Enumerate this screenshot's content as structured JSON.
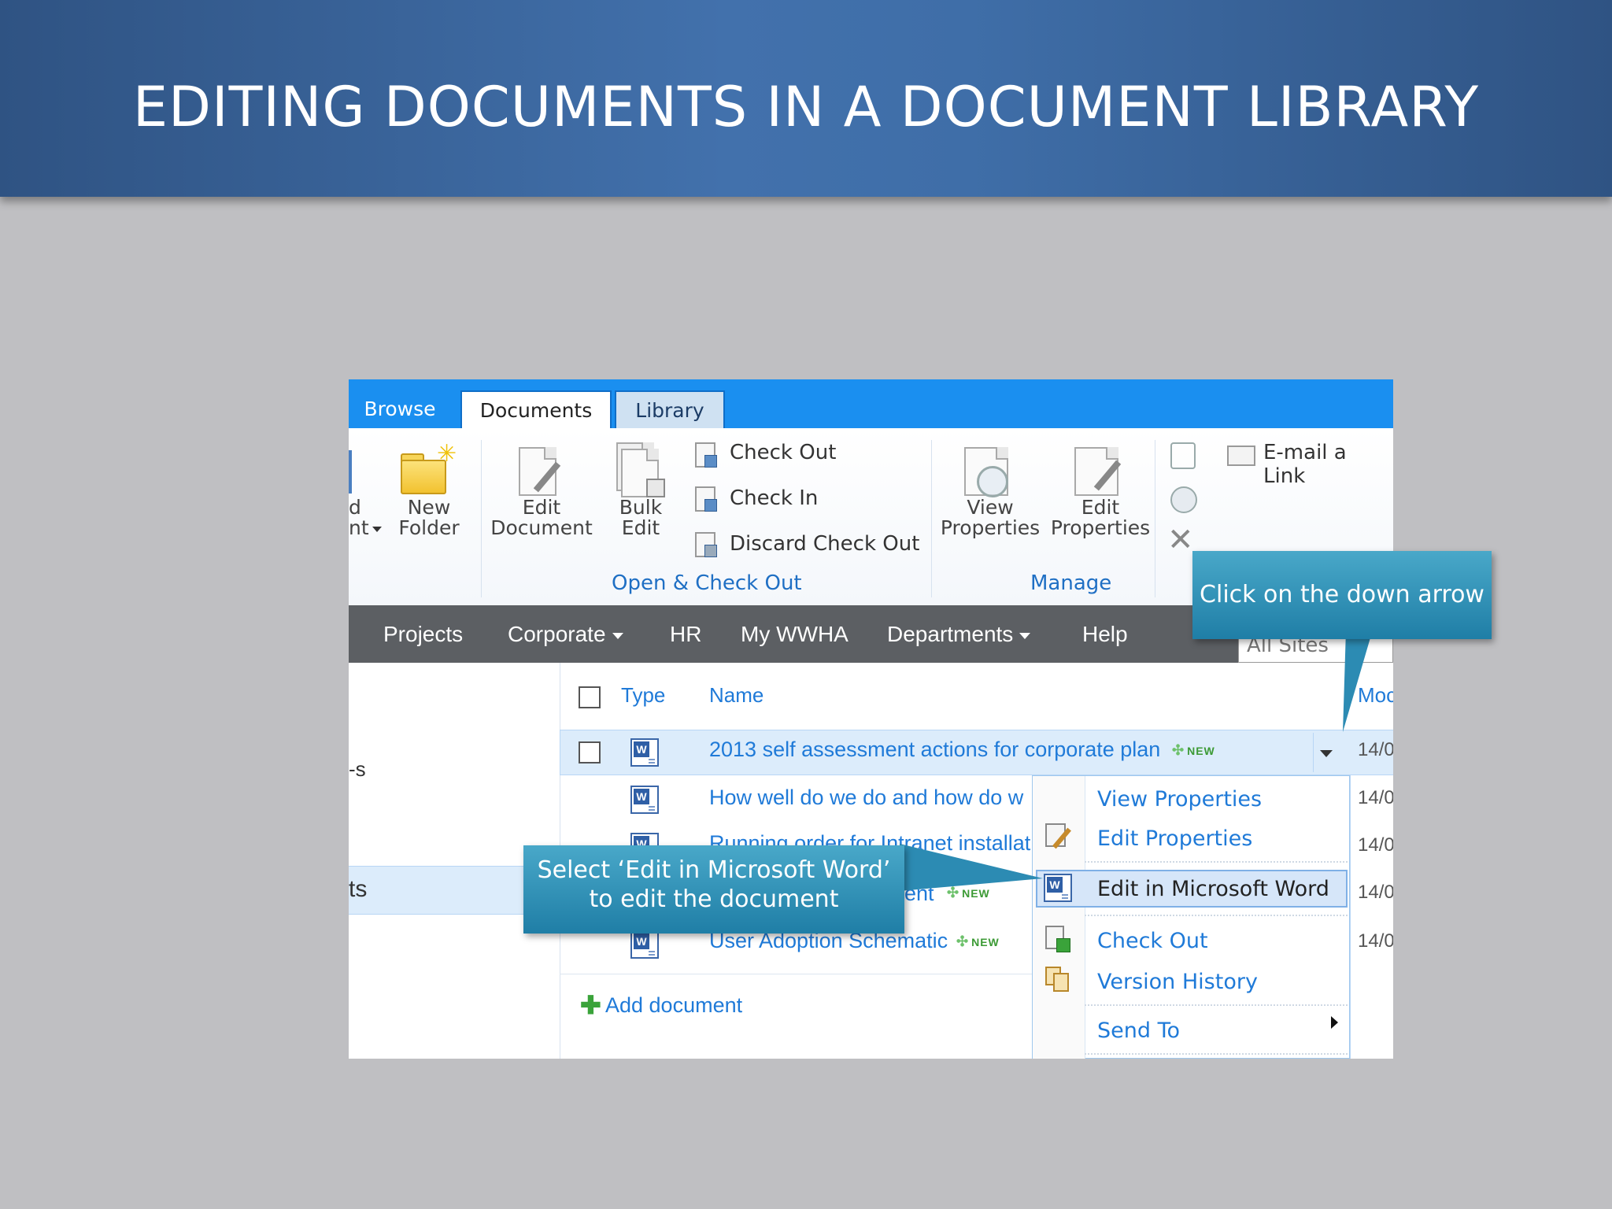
{
  "slide": {
    "title": "EDITING DOCUMENTS IN A DOCUMENT LIBRARY"
  },
  "ribbon": {
    "tabs": [
      "Browse",
      "Documents",
      "Library"
    ],
    "partial_new_doc_line1": "d",
    "partial_new_doc_line2": "nt",
    "new_folder_line1": "New",
    "new_folder_line2": "Folder",
    "edit_document_line1": "Edit",
    "edit_document_line2": "Document",
    "bulk_edit_line1": "Bulk",
    "bulk_edit_line2": "Edit",
    "check_out": "Check Out",
    "check_in": "Check In",
    "discard_check_out": "Discard Check Out",
    "group_open_checkout": "Open & Check Out",
    "view_properties_line1": "View",
    "view_properties_line2": "Properties",
    "edit_properties_line1": "Edit",
    "edit_properties_line2": "Properties",
    "group_manage": "Manage",
    "email_link": "E-mail a Link"
  },
  "nav": {
    "items": [
      "Projects",
      "Corporate",
      "HR",
      "My WWHA",
      "Departments",
      "Help"
    ],
    "search_placeholder": "All Sites"
  },
  "leftnav": {
    "item_partial_1": "-s",
    "item_partial_2": "ts"
  },
  "list": {
    "col_type": "Type",
    "col_name": "Name",
    "col_modified": "Moc",
    "rows": [
      {
        "name": "2013 self assessment actions for corporate plan",
        "new": "NEW",
        "date": "14/0"
      },
      {
        "name": "How well do we do and how do w",
        "date": "14/0"
      },
      {
        "name": "Running order for Intranet installatio",
        "date": "14/0"
      },
      {
        "name": "ent",
        "new": "NEW",
        "date": "14/0"
      },
      {
        "name": "User Adoption Schematic",
        "new": "NEW",
        "date": "14/0"
      }
    ],
    "add_document": "Add document"
  },
  "context_menu": {
    "items": [
      "View Properties",
      "Edit Properties",
      "Edit in Microsoft Word",
      "Check Out",
      "Version History",
      "Send To"
    ]
  },
  "callouts": {
    "arrow_tip": "Click on the down arrow",
    "edit_word_line1": "Select ‘Edit in Microsoft Word’",
    "edit_word_line2": "to edit the document"
  },
  "colors": {
    "title_bar": "#4271ac",
    "callout": "#2f8fb8",
    "link": "#1f7ad8",
    "ribbon_tab_bar": "#1a8ff0"
  }
}
